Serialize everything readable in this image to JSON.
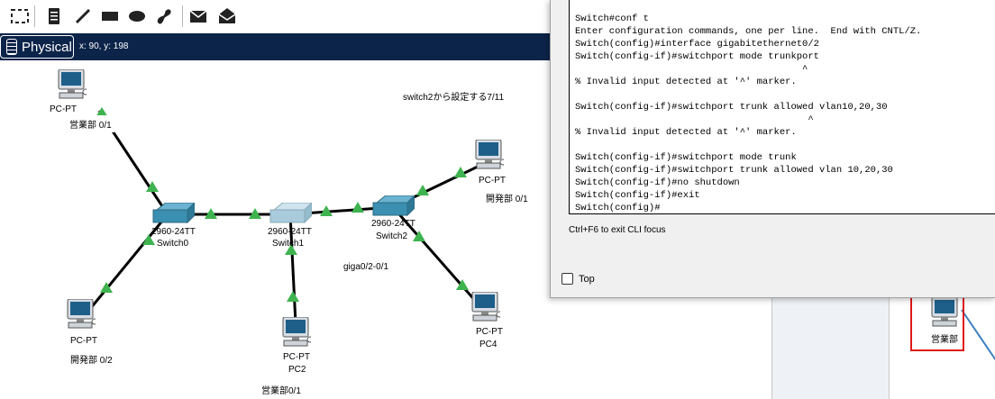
{
  "toolbar": {
    "tools": [
      "select-icon",
      "marquee-icon",
      "note-icon",
      "line-icon",
      "rectangle-icon",
      "ellipse-icon",
      "freeform-icon",
      "simple-pdu-icon",
      "complex-pdu-icon"
    ]
  },
  "modebar": {
    "mode_label": "Physical",
    "coords": "x: 90, y: 198"
  },
  "topology": {
    "devices": [
      {
        "model": "PC-PT",
        "name": "",
        "note": "営業部 0/1"
      },
      {
        "model": "PC-PT",
        "name": "",
        "note": "開発部 0/2"
      },
      {
        "model": "PC-PT",
        "name": "PC2",
        "note": "営業部0/1"
      },
      {
        "model": "PC-PT",
        "name": "",
        "note": "開発部 0/1"
      },
      {
        "model": "PC-PT",
        "name": "PC4",
        "note": ""
      },
      {
        "model": "2960-24TT",
        "name": "Switch0"
      },
      {
        "model": "2960-24TT",
        "name": "Switch1"
      },
      {
        "model": "2960-24TT",
        "name": "Switch2"
      }
    ],
    "notes": {
      "top": "switch2から設定する7/11",
      "mid": "giga0/2-0/1"
    }
  },
  "cli": {
    "lines": [
      "Switch#conf t",
      "Enter configuration commands, one per line.  End with CNTL/Z.",
      "Switch(config)#interface gigabitethernet0/2",
      "Switch(config-if)#switchport mode trunkport",
      "                                        ^",
      "% Invalid input detected at '^' marker.",
      "",
      "Switch(config-if)#switchport trunk allowed vlan10,20,30",
      "                                         ^",
      "% Invalid input detected at '^' marker.",
      "",
      "Switch(config-if)#switchport mode trunk",
      "Switch(config-if)#switchport trunk allowed vlan 10,20,30",
      "Switch(config-if)#no shutdown",
      "Switch(config-if)#exit",
      "Switch(config)#"
    ],
    "hint": "Ctrl+F6 to exit CLI focus",
    "top_label": "Top"
  },
  "background": {
    "pc_label": "営業部"
  },
  "colors": {
    "modebar": "#0c2449",
    "link_up": "#3fb34f",
    "switch_body": "#3b8fb0",
    "selected_box": "#e01818"
  }
}
